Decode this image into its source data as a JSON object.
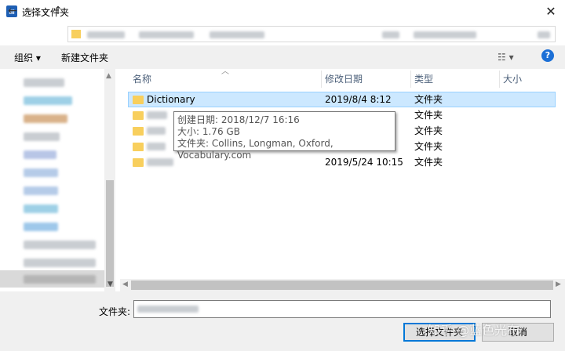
{
  "window": {
    "title": "选择文件夹",
    "app_icon": "folder-picker-icon"
  },
  "toolbar": {
    "organize": "组织 ▾",
    "new_folder": "新建文件夹"
  },
  "columns": {
    "name": "名称",
    "modified": "修改日期",
    "type": "类型",
    "size": "大小"
  },
  "rows": [
    {
      "name": "Dictionary",
      "modified": "2019/8/4 8:12",
      "type": "文件夹"
    },
    {
      "name": "",
      "modified": "",
      "type": "文件夹"
    },
    {
      "name": "",
      "modified": "",
      "type": "文件夹"
    },
    {
      "name": "",
      "modified": "",
      "type": "文件夹"
    },
    {
      "name": "",
      "modified": "2019/5/24 10:15",
      "type": "文件夹"
    }
  ],
  "tooltip": {
    "created": "创建日期: 2018/12/7 16:16",
    "size": "大小: 1.76 GB",
    "contents": "文件夹: Collins, Longman, Oxford, Vocabulary.com"
  },
  "footer": {
    "folder_label": "文件夹:",
    "select_button": "选择文件夹",
    "cancel_button": "取消"
  },
  "watermark": "知乎 @蓝色光布",
  "colors": {
    "selection": "#cce8ff",
    "accent": "#0078d7",
    "folder": "#f8cf5d"
  }
}
